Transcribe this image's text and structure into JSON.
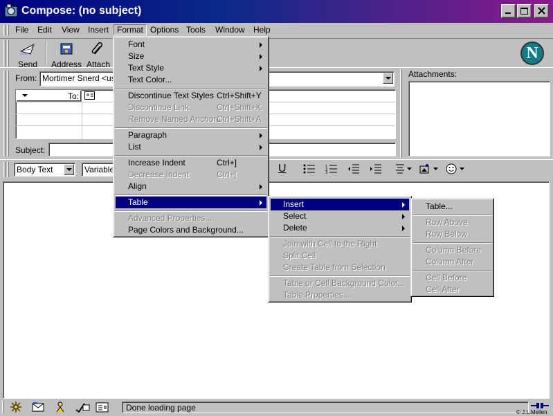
{
  "window": {
    "title": "Compose: (no subject)"
  },
  "menubar": [
    "File",
    "Edit",
    "View",
    "Insert",
    "Format",
    "Options",
    "Tools",
    "Window",
    "Help"
  ],
  "toolbar": {
    "send": "Send",
    "address": "Address",
    "attach": "Attach"
  },
  "address": {
    "from_label": "From:",
    "from_value": "Mortimer Snerd <user",
    "to_label": "To:",
    "subject_label": "Subject:"
  },
  "attachments": {
    "label": "Attachments:"
  },
  "format_bar": {
    "paragraph": "Body Text",
    "font": "Variable",
    "underline": "U"
  },
  "status": {
    "text": "Done loading page",
    "credit": "© J.L.Mellen"
  },
  "format_menu": [
    {
      "label": "Font",
      "submenu": true
    },
    {
      "label": "Size",
      "submenu": true
    },
    {
      "label": "Text Style",
      "submenu": true
    },
    {
      "label": "Text Color..."
    },
    {
      "sep": true
    },
    {
      "label": "Discontinue Text Styles",
      "shortcut": "Ctrl+Shift+Y"
    },
    {
      "label": "Discontinue Link",
      "shortcut": "Ctrl+Shift+K",
      "disabled": true
    },
    {
      "label": "Remove Named Anchors",
      "shortcut": "Ctrl+Shift+A",
      "disabled": true
    },
    {
      "sep": true
    },
    {
      "label": "Paragraph",
      "submenu": true
    },
    {
      "label": "List",
      "submenu": true
    },
    {
      "sep": true
    },
    {
      "label": "Increase Indent",
      "shortcut": "Ctrl+]"
    },
    {
      "label": "Decrease Indent",
      "shortcut": "Ctrl+[",
      "disabled": true
    },
    {
      "label": "Align",
      "submenu": true
    },
    {
      "sep": true
    },
    {
      "label": "Table",
      "submenu": true,
      "highlighted": true
    },
    {
      "sep": true
    },
    {
      "label": "Advanced Properties...",
      "disabled": true
    },
    {
      "label": "Page Colors and Background..."
    }
  ],
  "table_menu": [
    {
      "label": "Insert",
      "submenu": true,
      "highlighted": true
    },
    {
      "label": "Select",
      "submenu": true
    },
    {
      "label": "Delete",
      "submenu": true
    },
    {
      "sep": true
    },
    {
      "label": "Join with Cell to the Right",
      "disabled": true
    },
    {
      "label": "Split Cell",
      "disabled": true
    },
    {
      "label": "Create Table from Selection",
      "disabled": true
    },
    {
      "sep": true
    },
    {
      "label": "Table or Cell Background Color...",
      "disabled": true
    },
    {
      "label": "Table Properties...",
      "disabled": true
    }
  ],
  "insert_menu": [
    {
      "label": "Table..."
    },
    {
      "sep": true
    },
    {
      "label": "Row Above",
      "disabled": true
    },
    {
      "label": "Row Below",
      "disabled": true
    },
    {
      "sep": true
    },
    {
      "label": "Column Before",
      "disabled": true
    },
    {
      "label": "Column After",
      "disabled": true
    },
    {
      "sep": true
    },
    {
      "label": "Cell Before",
      "disabled": true
    },
    {
      "label": "Cell After",
      "disabled": true
    }
  ]
}
